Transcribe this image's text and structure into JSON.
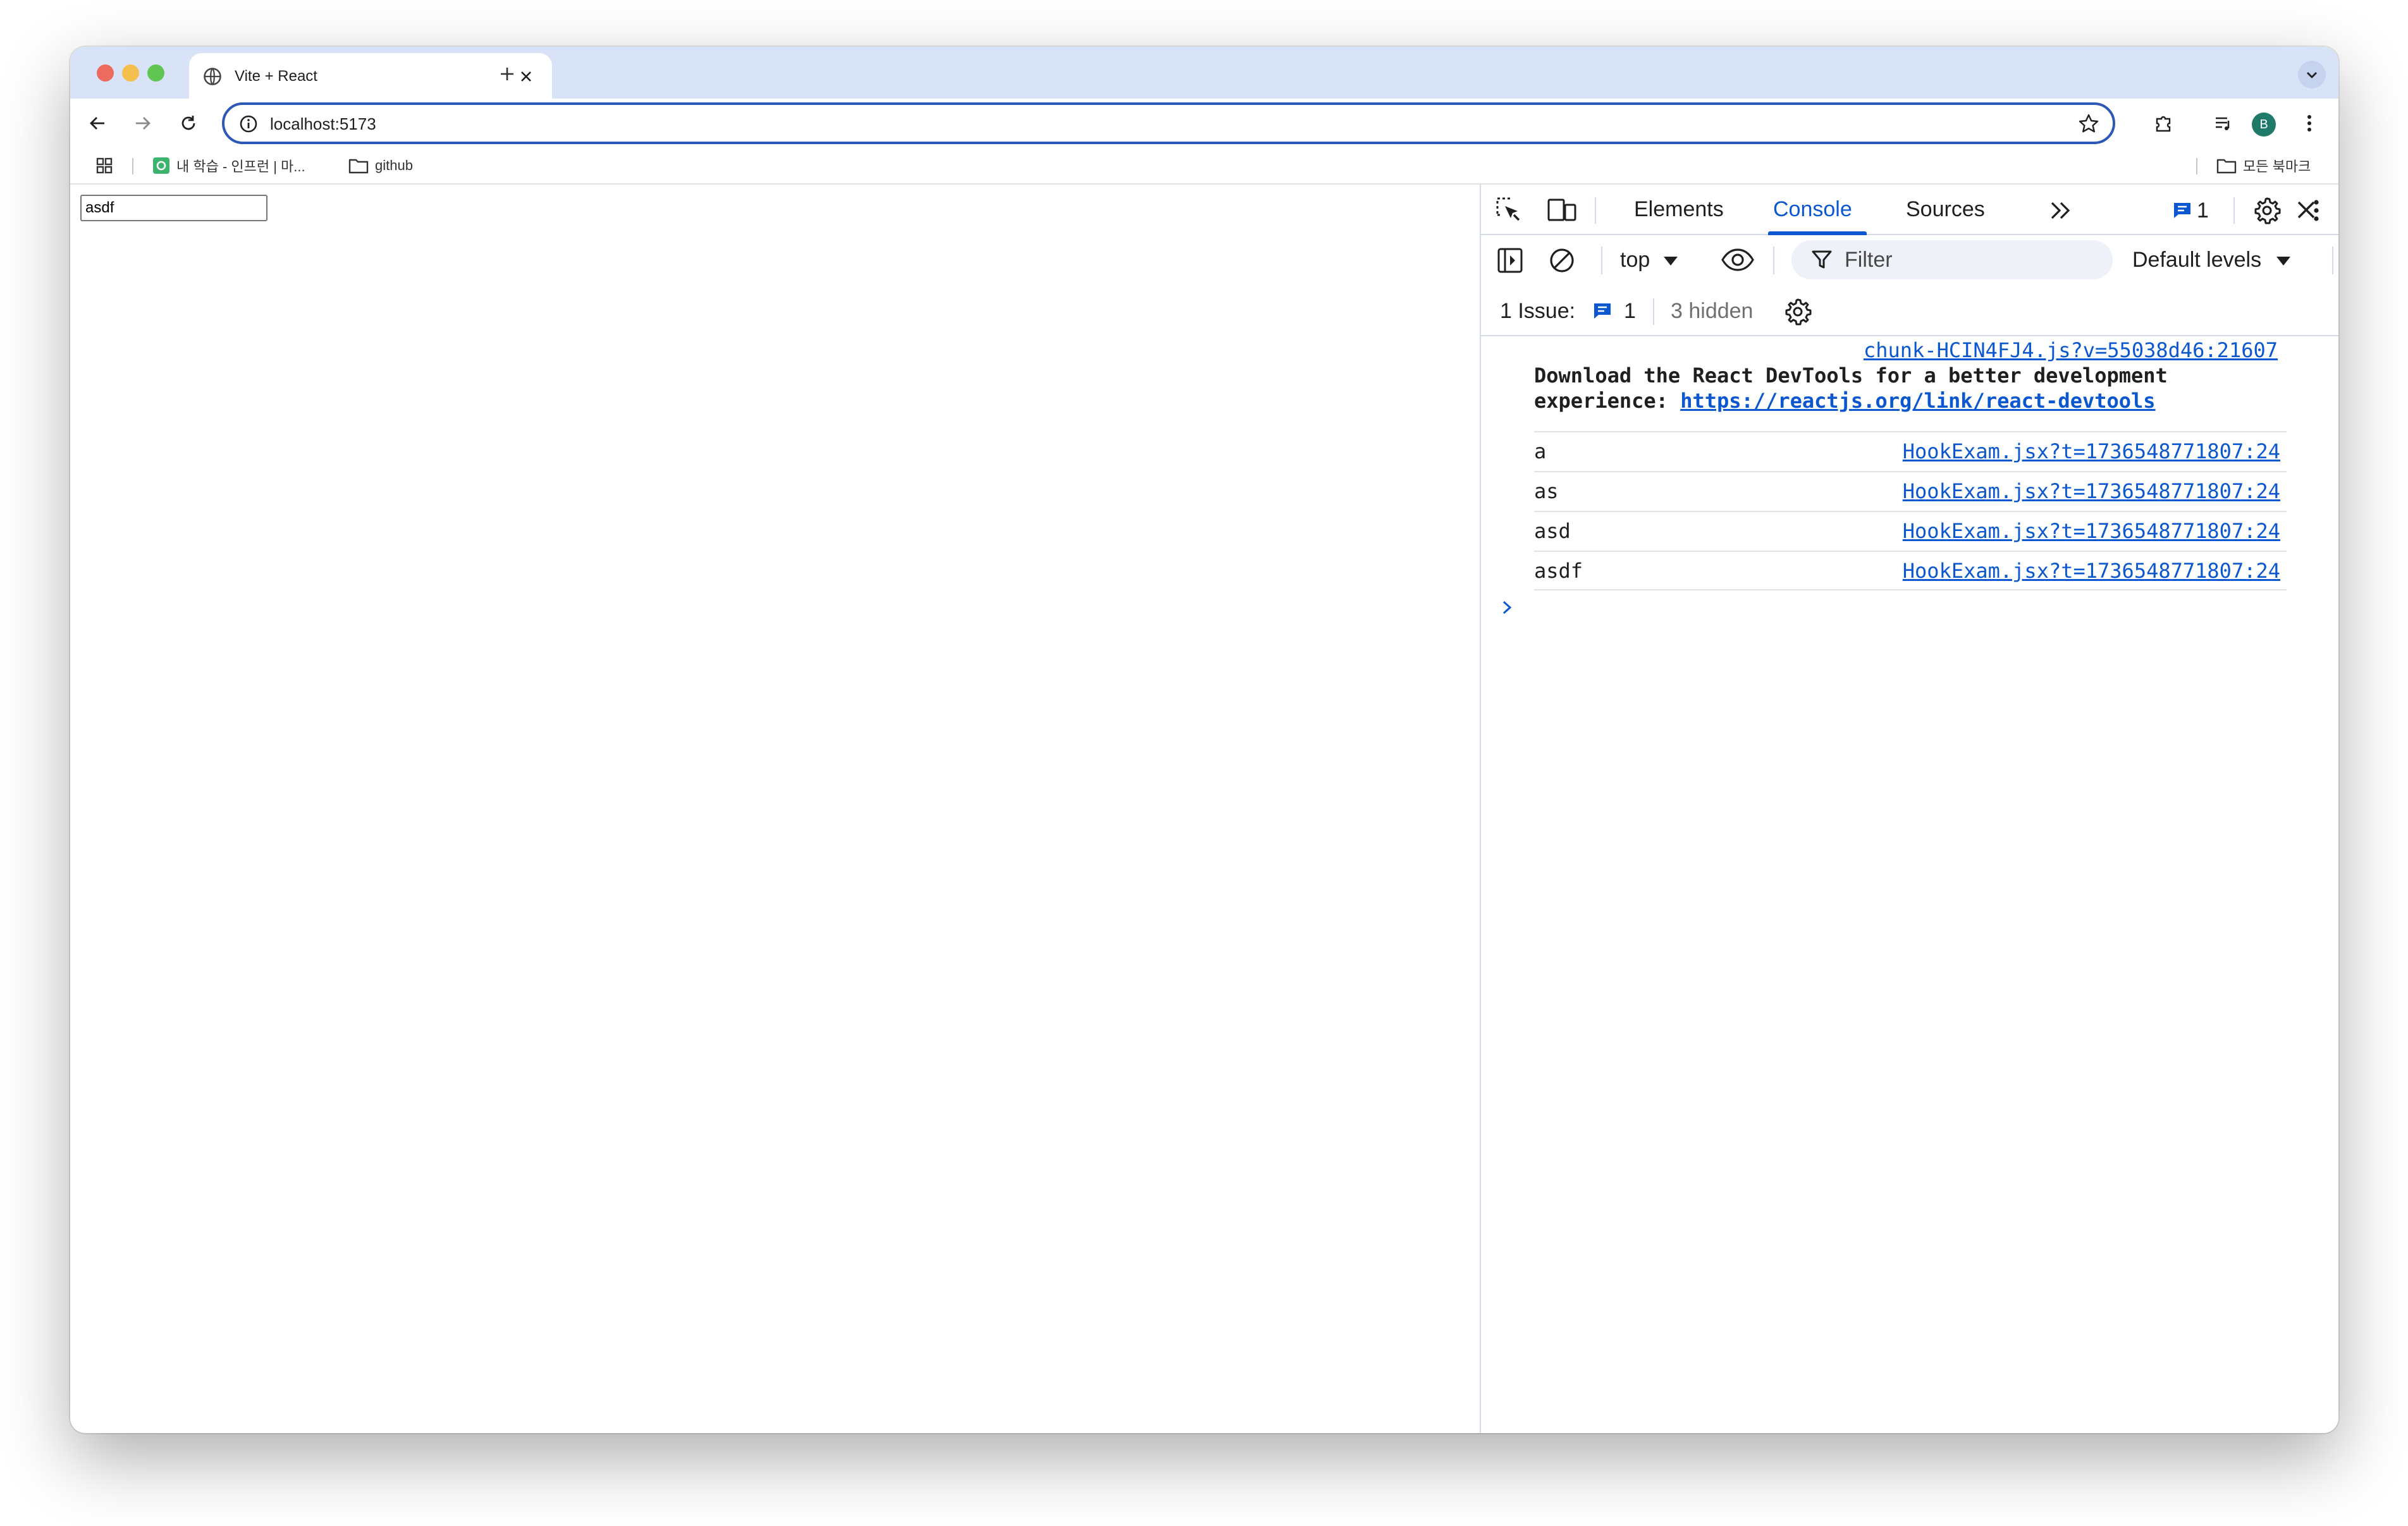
{
  "browser": {
    "tab_title": "Vite + React",
    "url": "localhost:5173",
    "profile_initial": "B",
    "bookmarks": [
      {
        "label": "내 학습 - 인프런 | 마..."
      },
      {
        "label": "github"
      }
    ],
    "all_bookmarks_label": "모든 북마크"
  },
  "page": {
    "input_value": "asdf"
  },
  "devtools": {
    "tabs": [
      {
        "label": "Elements"
      },
      {
        "label": "Console"
      },
      {
        "label": "Sources"
      }
    ],
    "issue_badge_count": "1",
    "context": "top",
    "filter_placeholder": "Filter",
    "levels": "Default levels",
    "issues_label": "1 Issue:",
    "issues_count": "1",
    "issues_hidden": "3 hidden",
    "console": {
      "devtools_message": {
        "source": "chunk-HCIN4FJ4.js?v=55038d46:21607",
        "text": "Download the React DevTools for a better development experience: ",
        "link": "https://reactjs.org/link/react-devtools"
      },
      "logs": [
        {
          "text": "a",
          "source": "HookExam.jsx?t=1736548771807:24"
        },
        {
          "text": "as",
          "source": "HookExam.jsx?t=1736548771807:24"
        },
        {
          "text": "asd",
          "source": "HookExam.jsx?t=1736548771807:24"
        },
        {
          "text": "asdf",
          "source": "HookExam.jsx?t=1736548771807:24"
        }
      ]
    }
  },
  "colors": {
    "accent": "#0b57d0",
    "tabstrip": "#d9e3f7",
    "omnibox_border": "#2c58b6"
  }
}
